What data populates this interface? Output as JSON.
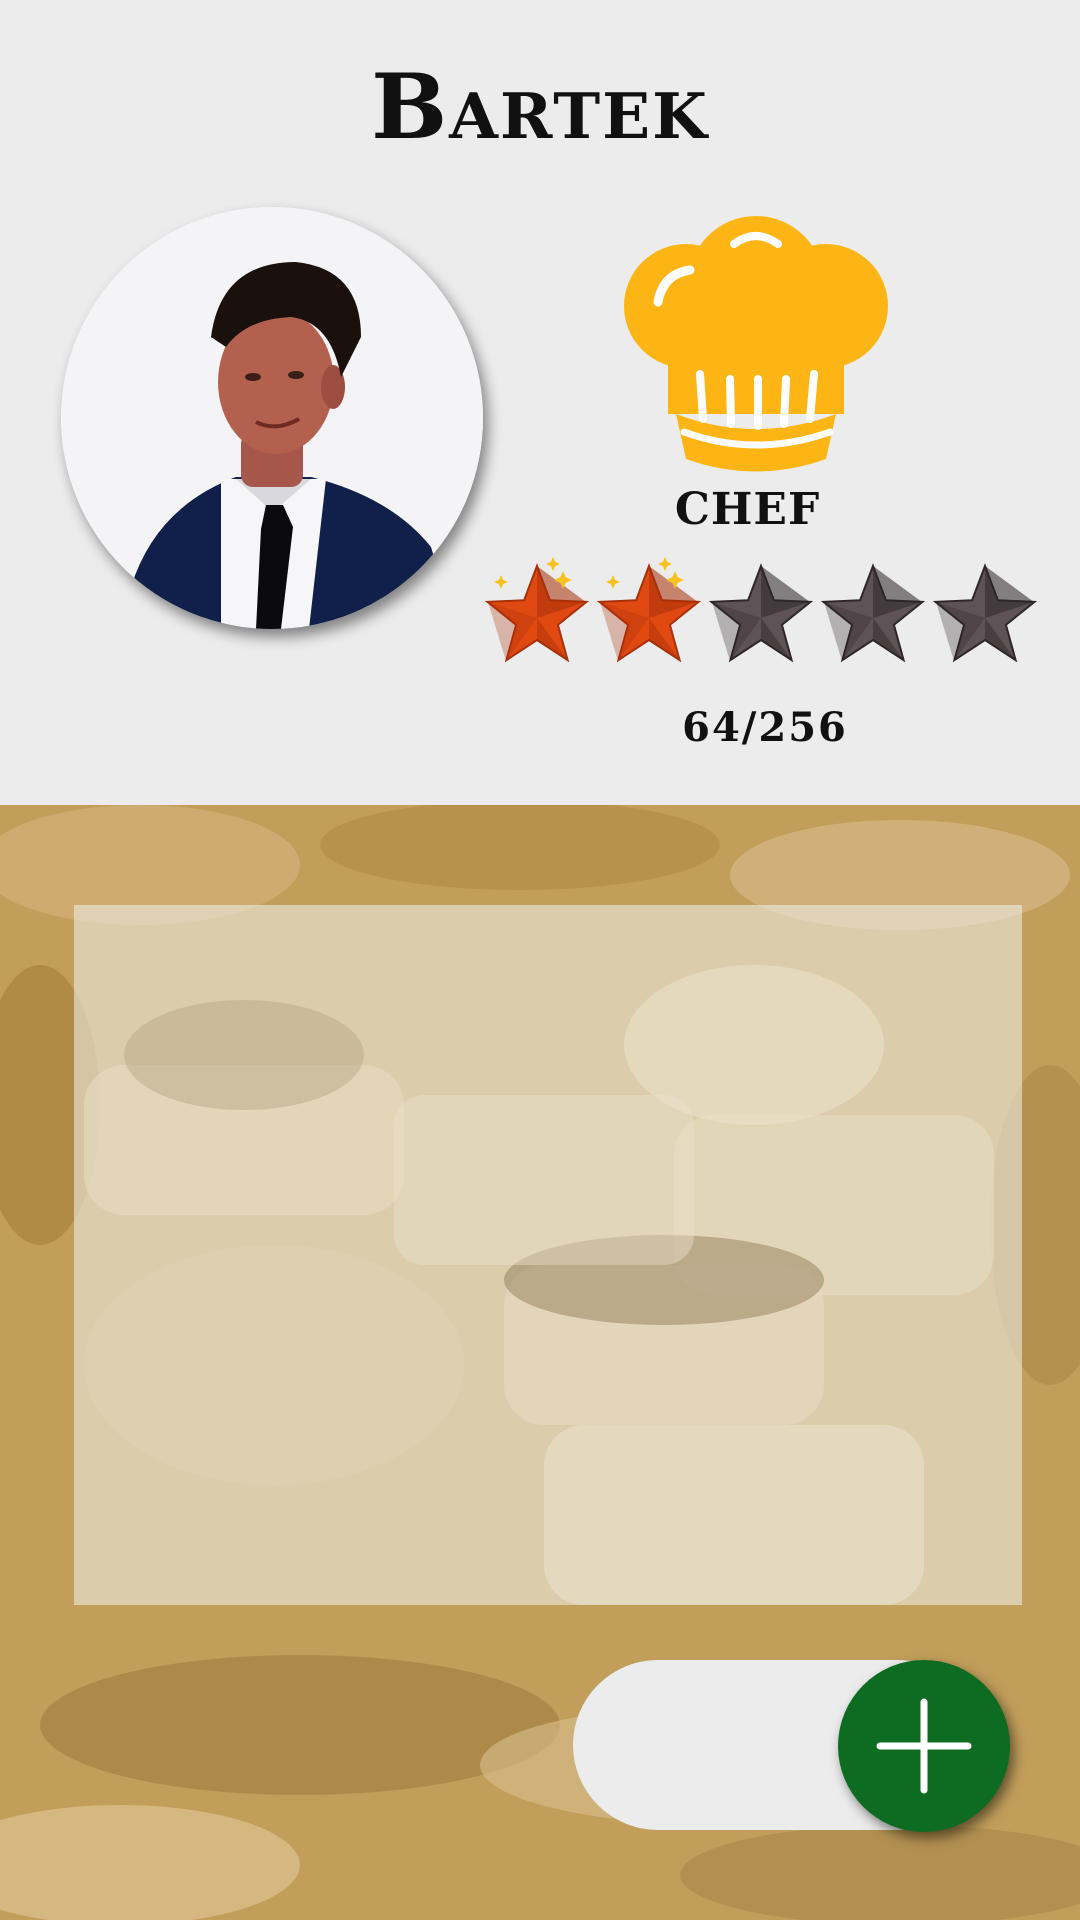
{
  "profile": {
    "name": "Bartek",
    "rank_label": "CHEF",
    "rank_icon": "chef-hat-icon",
    "avatar_icon": "user-photo",
    "rating": {
      "earned": 2,
      "total": 5,
      "earned_color": "#E04A12",
      "empty_color": "#5E5457"
    },
    "points_text": "64/256"
  },
  "fab": {
    "icon": "plus-icon",
    "color": "#0E6B22"
  },
  "colors": {
    "background": "#ECECEC",
    "food_tint": "#C19E5A",
    "accent_hat": "#FDB515"
  }
}
